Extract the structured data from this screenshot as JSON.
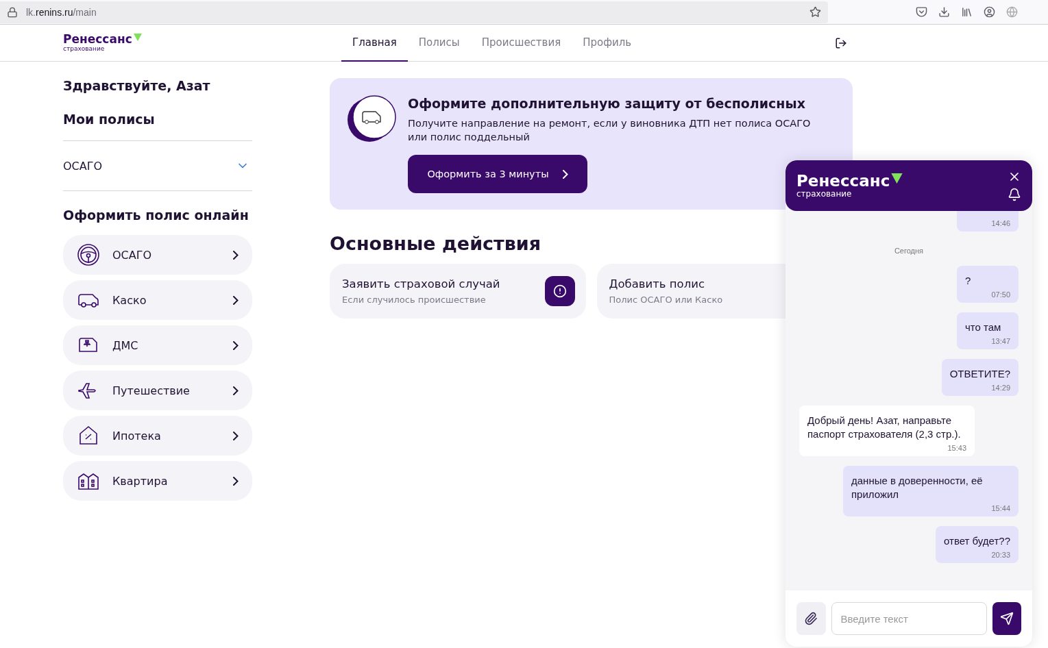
{
  "browser": {
    "url": "lk.**renins.ru**/main"
  },
  "logo": {
    "name": "Ренессанс",
    "sub": "страхование"
  },
  "nav": [
    {
      "label": "Главная",
      "selected": true
    },
    {
      "label": "Полисы",
      "selected": false
    },
    {
      "label": "Происшествия",
      "selected": false
    },
    {
      "label": "Профиль",
      "selected": false
    }
  ],
  "sidebar": {
    "greeting": "Здравствуйте, Азат",
    "my_policies_title": "Мои полисы",
    "policies": [
      {
        "label": "ОСАГО",
        "expanded": false
      }
    ],
    "buy_title": "Оформить полис онлайн",
    "products": [
      {
        "label": "ОСАГО",
        "kind": "wheel"
      },
      {
        "label": "Каско",
        "kind": "car"
      },
      {
        "label": "ДМС",
        "kind": "medical"
      },
      {
        "label": "Путешествие",
        "kind": "plane"
      },
      {
        "label": "Ипотека",
        "kind": "house"
      },
      {
        "label": "Квартира",
        "kind": "building"
      }
    ]
  },
  "promo": {
    "title": "Оформите дополнительную защиту от бесполисных",
    "text": "Получите направление на ремонт, если у виновника ДТП нет полиса ОСАГО или полис поддельный",
    "button": "Оформить за 3 минуты"
  },
  "actions": {
    "title": "Основные действия",
    "items": [
      {
        "title": "Заявить страховой случай",
        "subtitle": "Если случилось происшествие",
        "kind": "alert"
      },
      {
        "title": "Добавить полис",
        "subtitle": "Полис ОСАГО или Каско",
        "kind": "plain"
      }
    ]
  },
  "chat": {
    "logo": {
      "name": "Ренессанс",
      "sub": "страхование"
    },
    "messages": [
      {
        "kind": "partial",
        "outgoing": true,
        "time": "14:46"
      },
      {
        "kind": "date",
        "text": "Сегодня"
      },
      {
        "kind": "message",
        "outgoing": true,
        "text": "?",
        "time": "07:50"
      },
      {
        "kind": "message",
        "outgoing": true,
        "text": "что там",
        "time": "13:47"
      },
      {
        "kind": "message",
        "outgoing": true,
        "text": "ОТВЕТИТЕ?",
        "time": "14:29"
      },
      {
        "kind": "message",
        "outgoing": false,
        "text": "Добрый день! Азат, направьте паспорт страхователя (2,3 стр.).",
        "time": "15:43"
      },
      {
        "kind": "message",
        "outgoing": true,
        "text": "данные в доверенности, её приложил",
        "time": "15:44"
      },
      {
        "kind": "message",
        "outgoing": true,
        "text": "ответ будет??",
        "time": "20:33"
      }
    ],
    "input": {
      "placeholder": "Введите текст"
    }
  }
}
